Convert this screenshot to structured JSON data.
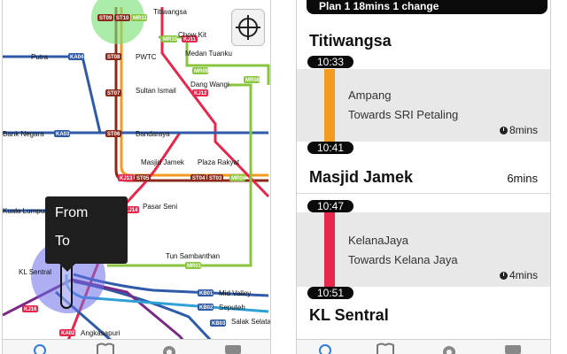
{
  "map": {
    "stations": [
      "Titiwangsa",
      "Chow Kit",
      "Putra",
      "PWTC",
      "Medan Tuanku",
      "Sultan Ismail",
      "Dang Wangi",
      "Bank Negara",
      "Bandaraya",
      "Masjid Jamek",
      "Plaza Rakyat",
      "Kuala Lumpur",
      "Pasar Seni",
      "Tun Sambanthan",
      "KL Sentral",
      "Mid Valley",
      "Seputeh",
      "Salak Selatan",
      "Angkasapuri"
    ],
    "codes": [
      "ST09",
      "ST10",
      "MR11",
      "KJ11",
      "MR10",
      "KA04",
      "ST08",
      "MR09",
      "ST07",
      "KJ12",
      "MR08",
      "KA03",
      "ST06",
      "KJ13",
      "ST05",
      "ST04",
      "ST03",
      "MR04",
      "KJ14",
      "MR01",
      "KB01",
      "KB02",
      "KB03",
      "KJ16",
      "KA02"
    ]
  },
  "callout": {
    "from": "From",
    "to": "To"
  },
  "plan": {
    "header": "Plan 1 18mins 1 change",
    "stops": [
      {
        "name": "Titiwangsa",
        "time": "10:33"
      },
      {
        "name": "Masjid Jamek",
        "arrive": "10:41",
        "depart": "10:47",
        "transfer": "6mins"
      },
      {
        "name": "KL Sentral",
        "time": "10:51"
      }
    ],
    "legs": [
      {
        "line": "Ampang",
        "direction": "Towards SRI Petaling",
        "duration": "8mins",
        "color": "#f39a1f"
      },
      {
        "line": "KelanaJaya",
        "direction": "Towards Kelana Jaya",
        "duration": "4mins",
        "color": "#e8264b"
      }
    ]
  },
  "colors": {
    "ampang": "#f39a1f",
    "kelana": "#e8264b",
    "monorail": "#8ac53f",
    "sri_petaling": "#8b2a1a",
    "ktm": "#2e5aa8",
    "erl": "#7a2a86"
  }
}
